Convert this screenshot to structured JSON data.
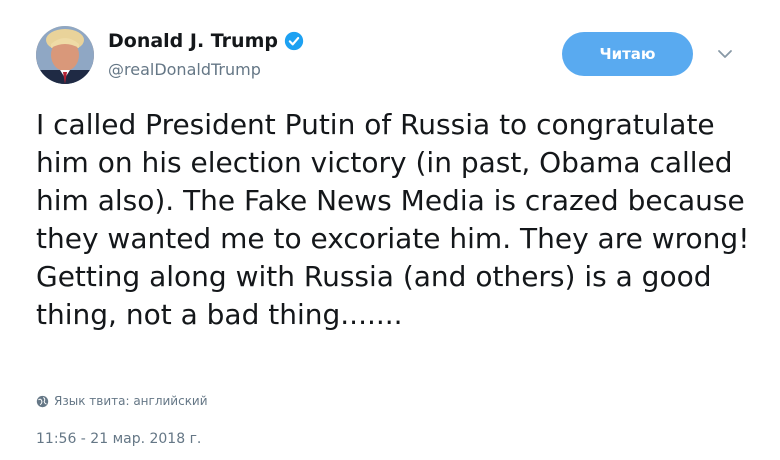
{
  "author": {
    "display_name": "Donald J. Trump",
    "handle": "@realDonaldTrump",
    "verified": true
  },
  "actions": {
    "follow_label": "Читаю"
  },
  "tweet": {
    "text": "I called President Putin of Russia to congratulate him on his election victory (in past, Obama called him also). The Fake News Media is crazed because they wanted me to excoriate him. They are wrong! Getting along with Russia (and others) is a good thing, not a bad thing.......",
    "language_label": "Язык твита: английский",
    "timestamp": "11:56 - 21 мар. 2018 г."
  },
  "colors": {
    "accent": "#59aaf0",
    "verified": "#1da1f2",
    "muted": "#657786",
    "text": "#14171a"
  },
  "icons": [
    "verified-icon",
    "chevron-down-icon",
    "globe-icon"
  ]
}
